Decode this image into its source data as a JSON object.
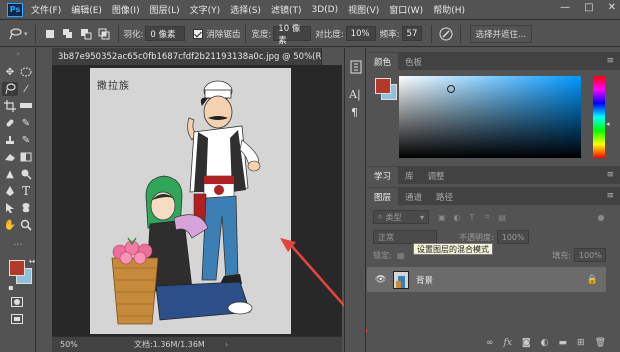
{
  "app": {
    "logo": "Ps"
  },
  "menu": [
    "文件(F)",
    "编辑(E)",
    "图像(I)",
    "图层(L)",
    "文字(Y)",
    "选择(S)",
    "滤镜(T)",
    "3D(D)",
    "视图(V)",
    "窗口(W)",
    "帮助(H)"
  ],
  "window_controls": {
    "minimize": "—",
    "maximize": "□",
    "close": "✕"
  },
  "options": {
    "feather_label": "羽化:",
    "feather_value": "0 像素",
    "antialias_label": "消除锯齿",
    "width_label": "宽度:",
    "width_value": "10 像素",
    "contrast_label": "对比度:",
    "contrast_value": "10%",
    "frequency_label": "频率:",
    "frequency_value": "57",
    "select_mask_button": "选择并遮住..."
  },
  "document": {
    "tab_title": "3b87e950352ac65c0fb1687cfdf2b21193138a0c.jpg @ 50%(RG...",
    "tab_close": "×",
    "canvas_text": "撒拉族",
    "zoom": "50%",
    "doc_info": "文档:1.36M/1.36M"
  },
  "colors": {
    "foreground": "#b33a2a",
    "background": "#8fc1d8",
    "accent_arrow": "#e3443c",
    "picker_hue": "#0099ff"
  },
  "color_panel": {
    "tabs": [
      "颜色",
      "色板"
    ]
  },
  "learn_panel": {
    "tabs": [
      "学习",
      "库",
      "调整"
    ]
  },
  "layers_panel": {
    "tabs": [
      "图层",
      "通道",
      "路径"
    ],
    "kind_filter": "类型",
    "blend_mode": "正常",
    "opacity_label": "不透明度:",
    "opacity_value": "100%",
    "lock_label": "锁定:",
    "fill_label": "填充:",
    "fill_value": "100%",
    "tooltip": "设置图层的混合模式",
    "layer_name": "背景"
  },
  "strip_icons": [
    "history-icon",
    "character-icon",
    "paragraph-icon"
  ],
  "strip_labels": {
    "character": "A|",
    "paragraph": "¶"
  }
}
